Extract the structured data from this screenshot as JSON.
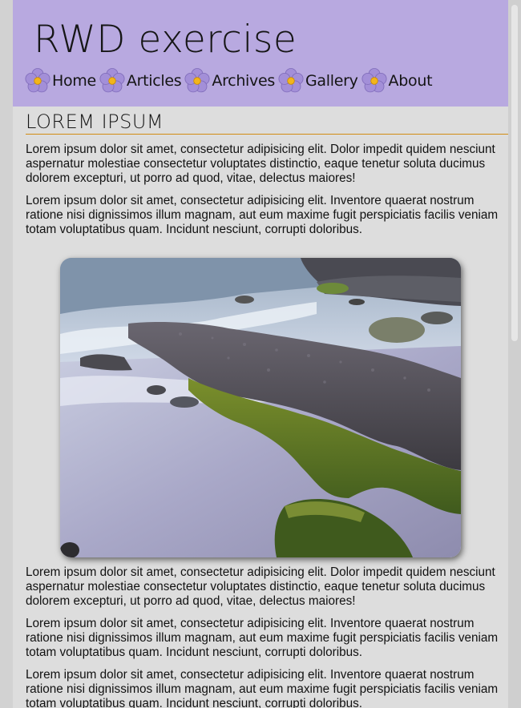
{
  "header": {
    "title": "RWD exercise",
    "nav": [
      {
        "label": "Home",
        "icon": "flower-icon"
      },
      {
        "label": "Articles",
        "icon": "flower-icon"
      },
      {
        "label": "Archives",
        "icon": "flower-icon"
      },
      {
        "label": "Gallery",
        "icon": "flower-icon"
      },
      {
        "label": "About",
        "icon": "flower-icon"
      }
    ]
  },
  "main": {
    "heading": "LOREM IPSUM",
    "paragraphs": [
      "Lorem ipsum dolor sit amet, consectetur adipisicing elit. Dolor impedit quidem nesciunt aspernatur molestiae consectetur voluptates distinctio, eaque tenetur soluta ducimus dolorem excepturi, ut porro ad quod, vitae, delectus maiores!",
      "Lorem ipsum dolor sit amet, consectetur adipisicing elit. Inventore quaerat nostrum ratione nisi dignissimos illum magnam, aut eum maxime fugit perspiciatis facilis veniam totam voluptatibus quam. Incidunt nesciunt, corrupti doloribus.",
      "Lorem ipsum dolor sit amet, consectetur adipisicing elit. Dolor impedit quidem nesciunt aspernatur molestiae consectetur voluptates distinctio, eaque tenetur soluta ducimus dolorem excepturi, ut porro ad quod, vitae, delectus maiores!",
      "Lorem ipsum dolor sit amet, consectetur adipisicing elit. Inventore quaerat nostrum ratione nisi dignissimos illum magnam, aut eum maxime fugit perspiciatis facilis veniam totam voluptatibus quam. Incidunt nesciunt, corrupti doloribus.",
      "Lorem ipsum dolor sit amet, consectetur adipisicing elit. Inventore quaerat nostrum ratione nisi dignissimos illum magnam, aut eum maxime fugit perspiciatis facilis veniam totam voluptatibus quam. Incidunt nesciunt, corrupti doloribus."
    ],
    "image": {
      "subject": "mossy rock ledge on a beach"
    }
  },
  "colors": {
    "header_bg": "#b8a9e0",
    "page_bg": "#dddddd",
    "heading_rule": "#d18b12",
    "flower_petal": "#a38fd8",
    "flower_center": "#f2b51c"
  }
}
